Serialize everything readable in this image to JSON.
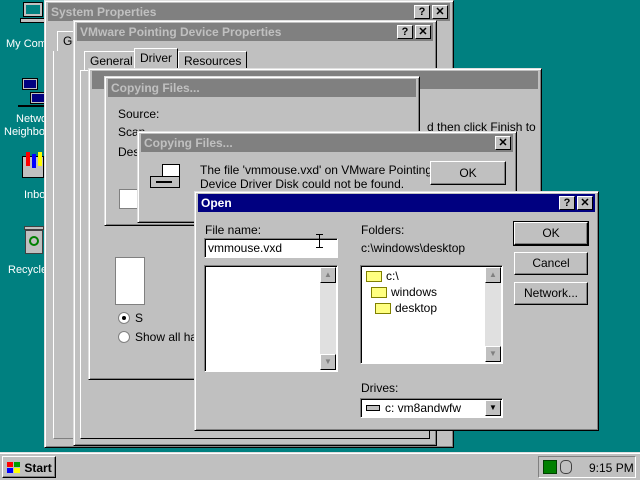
{
  "desktop": {
    "icons": [
      {
        "label": "My Com"
      },
      {
        "label": "Netwo"
      },
      {
        "label": "Neighbo"
      },
      {
        "label": "Inbo"
      },
      {
        "label": "Recycle"
      }
    ]
  },
  "system_properties": {
    "title": "System Properties",
    "tab_fragment": "Ge"
  },
  "vmware_props": {
    "title": "VMware Pointing Device Properties",
    "tabs": [
      "General",
      "Driver",
      "Resources"
    ]
  },
  "wizard": {
    "text_fragment": "d then click Finish to"
  },
  "copying_back": {
    "title": "Copying Files...",
    "source_label": "Source:",
    "scan_fragment": "Scan",
    "dest_fragment": "Dest"
  },
  "device_options": {
    "radio1_fragment": "S",
    "radio2_label": "Show all har"
  },
  "copying_front": {
    "title": "Copying Files...",
    "message_line1": "The file 'vmmouse.vxd' on VMware Pointing",
    "message_line2": "Device Driver Disk could not be found.",
    "ok_label": "OK"
  },
  "open_dialog": {
    "title": "Open",
    "file_name_label": "File name:",
    "file_name_value": "vmmouse.vxd",
    "folders_label": "Folders:",
    "current_path": "c:\\windows\\desktop",
    "folder_tree": [
      "c:\\",
      "windows",
      "desktop"
    ],
    "drives_label": "Drives:",
    "drive_value": "c: vm8andwfw",
    "ok_label": "OK",
    "cancel_label": "Cancel",
    "network_label": "Network..."
  },
  "taskbar": {
    "start_label": "Start",
    "clock": "9:15 PM"
  },
  "titlebar_buttons": {
    "help": "?",
    "close": "✕"
  }
}
